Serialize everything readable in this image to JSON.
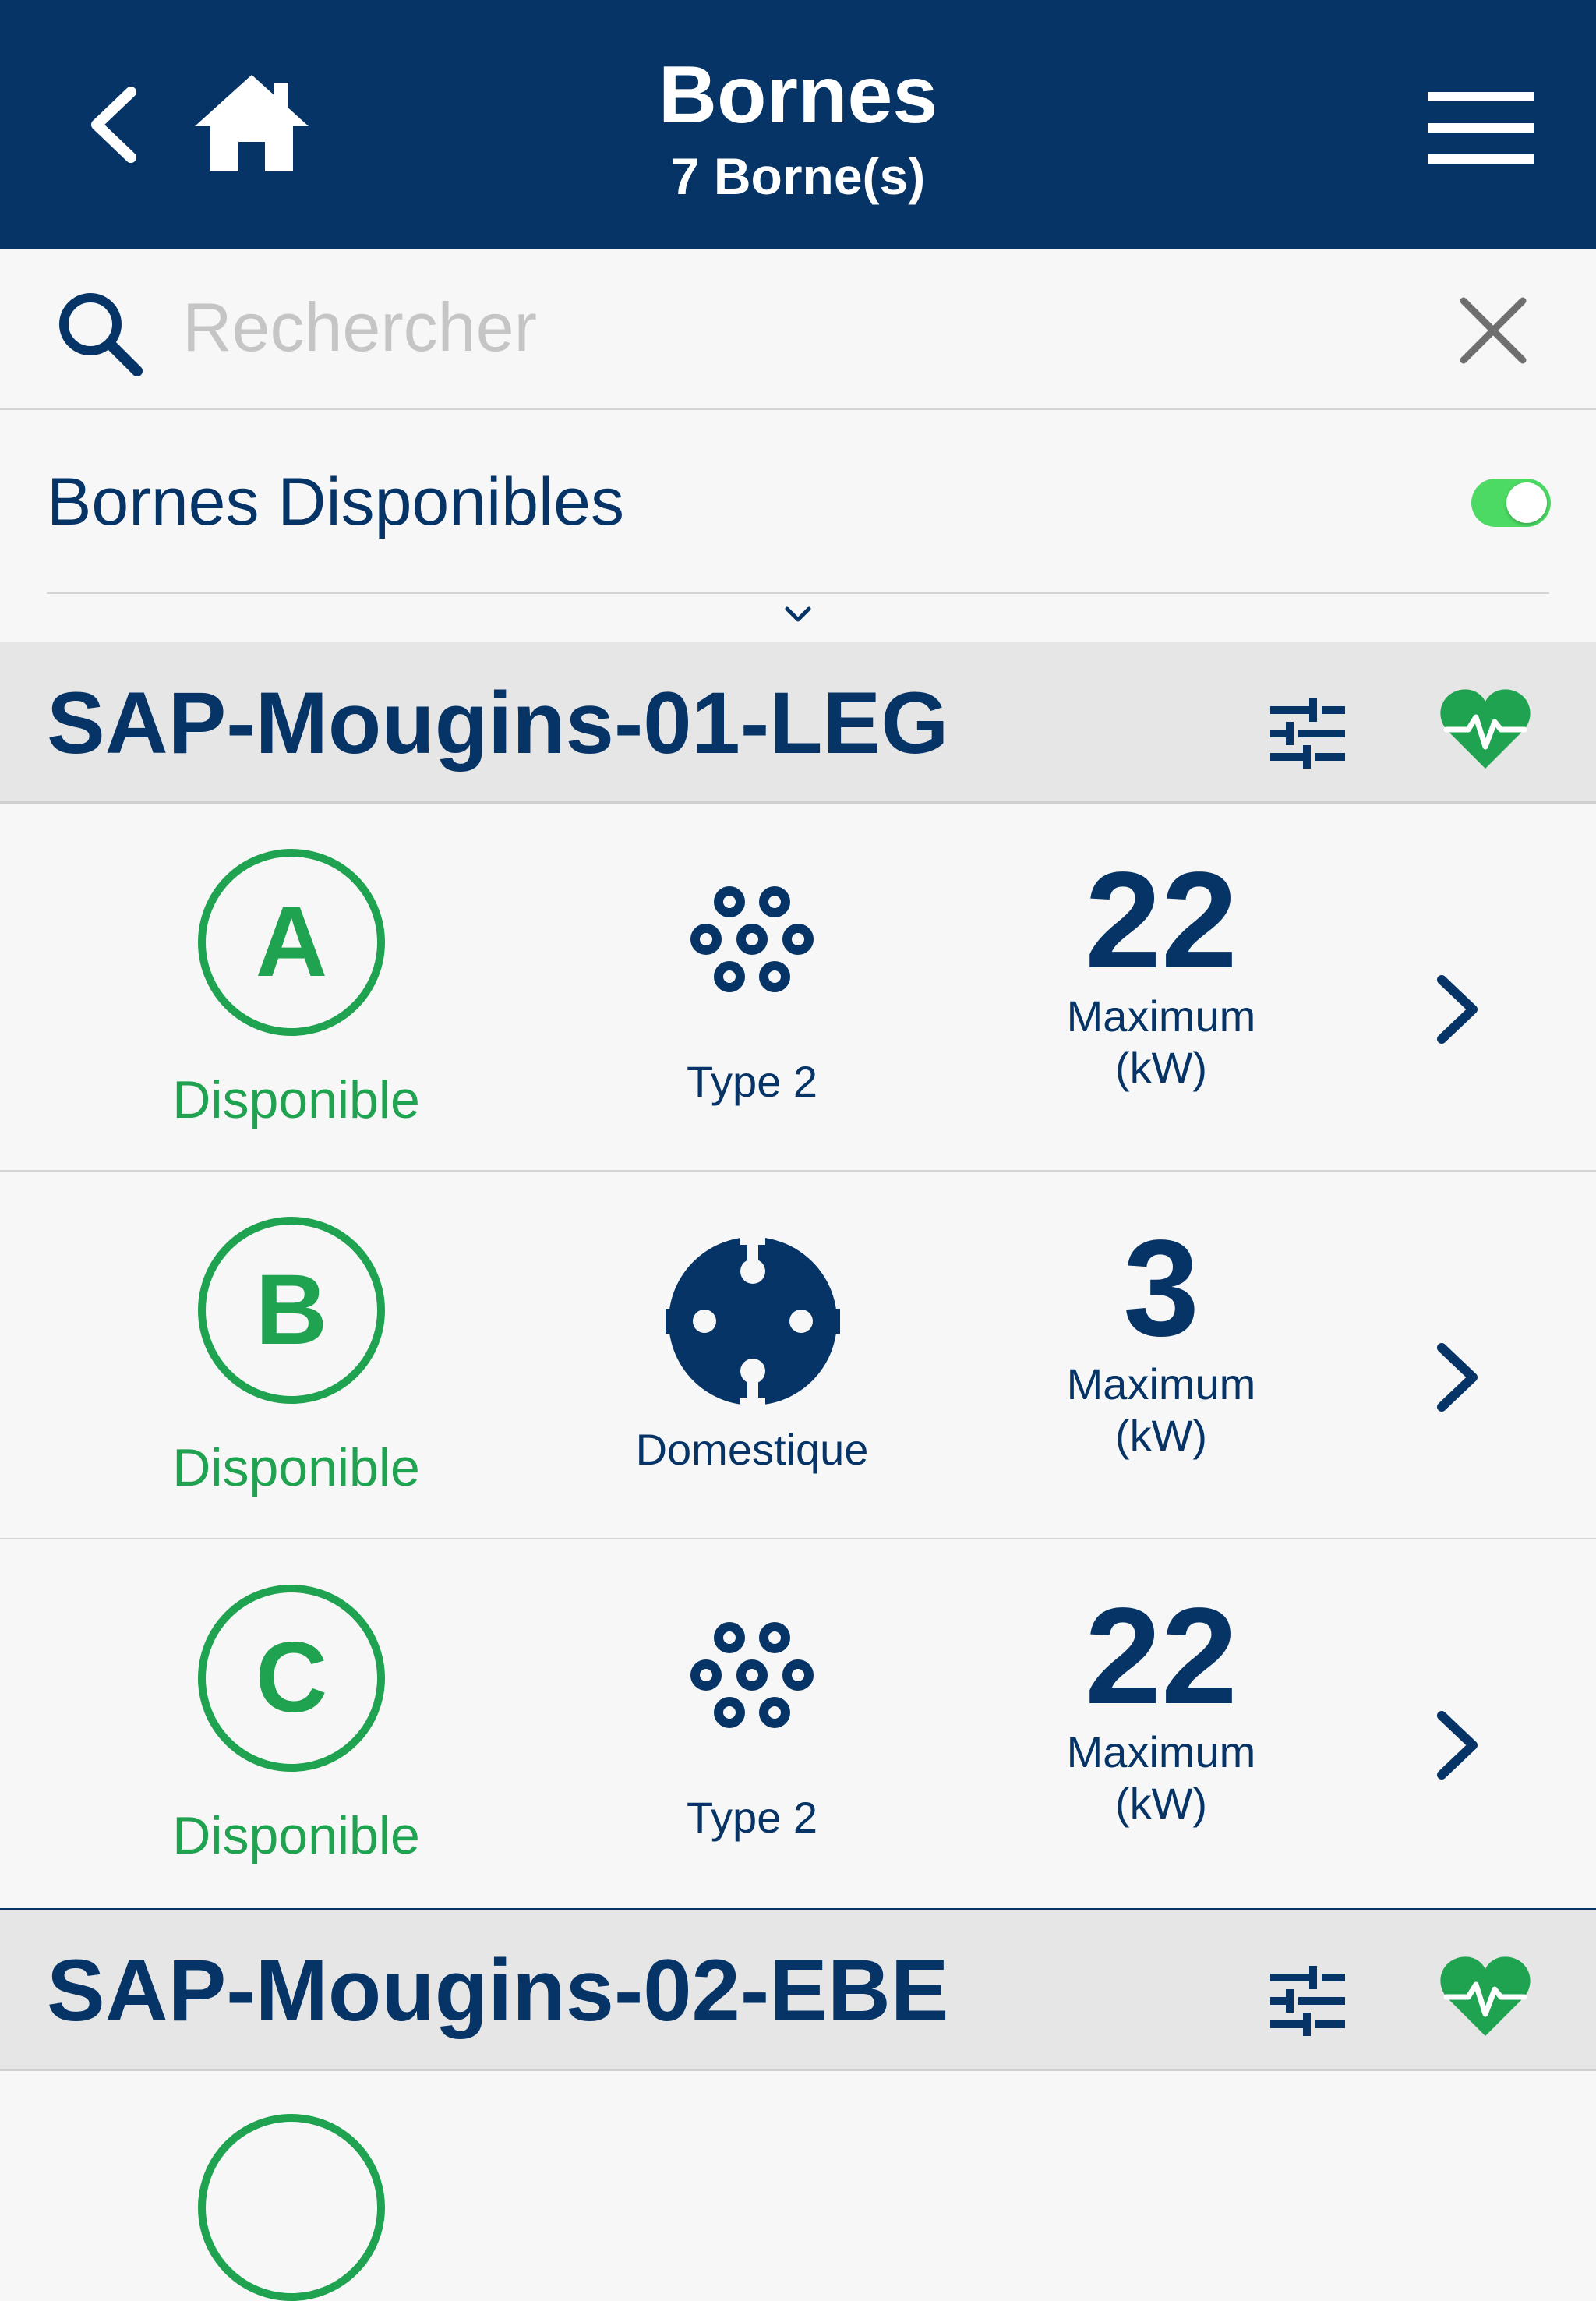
{
  "header": {
    "title": "Bornes",
    "subtitle": "7 Borne(s)",
    "back_icon": "chevron-left-icon",
    "home_icon": "home-icon",
    "menu_icon": "hamburger-menu-icon"
  },
  "search": {
    "placeholder": "Rechercher",
    "value": "",
    "search_icon": "search-icon",
    "clear_icon": "close-icon"
  },
  "filter": {
    "label": "Bornes Disponibles",
    "enabled": true
  },
  "colors": {
    "navy": "#063466",
    "green": "#20a350",
    "toggle_green": "#4cd964",
    "section_bg": "#e6e6e6",
    "row_bg": "#f7f7f7"
  },
  "stations": [
    {
      "name": "SAP-Mougins-01-LEG",
      "connectors": [
        {
          "letter": "A",
          "status": "Disponible",
          "plug": "Type 2",
          "plug_icon": "type2-plug-icon",
          "power": "22",
          "power_label": "Maximum\n(kW)"
        },
        {
          "letter": "B",
          "status": "Disponible",
          "plug": "Domestique",
          "plug_icon": "domestic-plug-icon",
          "power": "3",
          "power_label": "Maximum\n(kW)"
        },
        {
          "letter": "C",
          "status": "Disponible",
          "plug": "Type 2",
          "plug_icon": "type2-plug-icon",
          "power": "22",
          "power_label": "Maximum\n(kW)"
        }
      ]
    },
    {
      "name": "SAP-Mougins-02-EBE",
      "connectors": []
    }
  ]
}
